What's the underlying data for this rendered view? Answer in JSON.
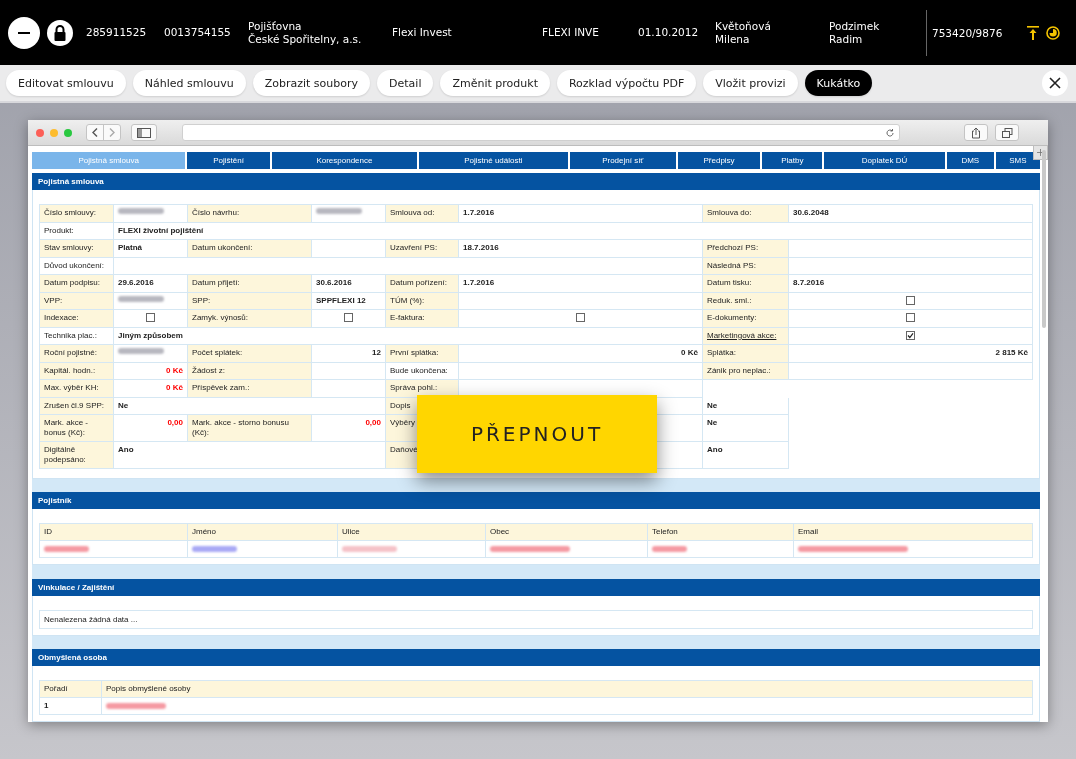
{
  "top_bar": {
    "items": [
      "285911525",
      "0013754155",
      "Pojišťovna\nČeské Spořitelny, a.s.",
      "Flexi Invest",
      "FLEXI INVE",
      "01.10.2012",
      "Květoňová\nMilena",
      "Podzimek\nRadim"
    ],
    "reference": "753420/9876"
  },
  "actions": [
    {
      "label": "Editovat smlouvu",
      "selected": false
    },
    {
      "label": "Náhled smlouvu",
      "selected": false
    },
    {
      "label": "Zobrazit soubory",
      "selected": false
    },
    {
      "label": "Detail",
      "selected": false
    },
    {
      "label": "Změnit produkt",
      "selected": false
    },
    {
      "label": "Rozklad výpočtu PDF",
      "selected": false
    },
    {
      "label": "Vložit provizi",
      "selected": false
    },
    {
      "label": "Kukátko",
      "selected": true
    }
  ],
  "browser": {
    "tabs": [
      {
        "label": "Pojistná smlouva",
        "selected": true
      },
      {
        "label": "Pojištění",
        "selected": false
      },
      {
        "label": "Korespondence",
        "selected": false
      },
      {
        "label": "Pojistné události",
        "selected": false
      },
      {
        "label": "Prodejní síť",
        "selected": false
      },
      {
        "label": "Předpisy",
        "selected": false
      },
      {
        "label": "Platby",
        "selected": false
      },
      {
        "label": "Doplatek DÚ",
        "selected": false
      },
      {
        "label": "DMS",
        "selected": false
      },
      {
        "label": "SMS",
        "selected": false
      }
    ]
  },
  "contract": {
    "title": "Pojistná smlouva",
    "rows": [
      [
        {
          "kind": "label",
          "text": "Číslo smlouvy:"
        },
        {
          "kind": "blurred",
          "color": "#b8b8c0"
        },
        {
          "kind": "label",
          "text": "Číslo návrhu:"
        },
        {
          "kind": "blurred",
          "color": "#b8b8c0"
        },
        {
          "kind": "label",
          "text": "Smlouva od:"
        },
        {
          "kind": "value",
          "text": "1.7.2016"
        },
        {
          "kind": "label",
          "text": "Smlouva do:"
        },
        {
          "kind": "value",
          "text": "30.6.2048"
        }
      ],
      [
        {
          "kind": "plain",
          "text": "Produkt:"
        },
        {
          "kind": "wide",
          "text": "FLEXI životní pojištění"
        }
      ],
      [
        {
          "kind": "label",
          "text": "Stav smlouvy:"
        },
        {
          "kind": "value",
          "text": "Platná"
        },
        {
          "kind": "label",
          "text": "Datum ukončení:"
        },
        {
          "kind": "blank"
        },
        {
          "kind": "label",
          "text": "Uzavření PS:"
        },
        {
          "kind": "value",
          "text": "18.7.2016"
        },
        {
          "kind": "label",
          "text": "Předchozí PS:"
        },
        {
          "kind": "blank"
        }
      ],
      [
        {
          "kind": "plain",
          "text": "Důvod ukončení:"
        },
        {
          "kind": "wide"
        },
        {
          "kind": "label",
          "text": "Následná PS:"
        },
        {
          "kind": "blank"
        }
      ],
      [
        {
          "kind": "label",
          "text": "Datum podpisu:"
        },
        {
          "kind": "value",
          "text": "29.6.2016"
        },
        {
          "kind": "label",
          "text": "Datum přijetí:"
        },
        {
          "kind": "value",
          "text": "30.6.2016"
        },
        {
          "kind": "label",
          "text": "Datum pořízení:"
        },
        {
          "kind": "value",
          "text": "1.7.2016"
        },
        {
          "kind": "label",
          "text": "Datum tisku:"
        },
        {
          "kind": "value",
          "text": "8.7.2016"
        }
      ],
      [
        {
          "kind": "label",
          "text": "VPP:"
        },
        {
          "kind": "blurred",
          "color": "#b8b8c0"
        },
        {
          "kind": "label",
          "text": "SPP:"
        },
        {
          "kind": "value",
          "text": "SPPFLEXI 12"
        },
        {
          "kind": "label",
          "text": "TÚM (%):"
        },
        {
          "kind": "blank"
        },
        {
          "kind": "label",
          "text": "Reduk. sml.:"
        },
        {
          "kind": "check",
          "checked": false
        }
      ],
      [
        {
          "kind": "label",
          "text": "Indexace:"
        },
        {
          "kind": "check",
          "checked": false
        },
        {
          "kind": "label",
          "text": "Zamyk. výnosů:"
        },
        {
          "kind": "check",
          "checked": false
        },
        {
          "kind": "label",
          "text": "E-faktura:"
        },
        {
          "kind": "check",
          "checked": false
        },
        {
          "kind": "label",
          "text": "E-dokumenty:"
        },
        {
          "kind": "check",
          "checked": false
        }
      ],
      [
        {
          "kind": "plain",
          "text": "Technika plac.:"
        },
        {
          "kind": "wide",
          "text": "Jiným způsobem"
        },
        {
          "kind": "link",
          "text": "Marketingová akce:"
        },
        {
          "kind": "check",
          "checked": true
        }
      ],
      [
        {
          "kind": "label",
          "text": "Roční pojistné:"
        },
        {
          "kind": "blurred",
          "color": "#b8b8c0"
        },
        {
          "kind": "label",
          "text": "Počet splátek:"
        },
        {
          "kind": "amount",
          "text": "12"
        },
        {
          "kind": "label",
          "text": "První splátka:"
        },
        {
          "kind": "amount",
          "text": "0 Kč"
        },
        {
          "kind": "label",
          "text": "Splátka:"
        },
        {
          "kind": "amount",
          "text": "2 815 Kč"
        }
      ],
      [
        {
          "kind": "label",
          "text": "Kapitál. hodn.:"
        },
        {
          "kind": "alert",
          "text": "0 Kč"
        },
        {
          "kind": "label",
          "text": "Žádost z:"
        },
        {
          "kind": "blank"
        },
        {
          "kind": "plain",
          "text": "Bude ukončena:"
        },
        {
          "kind": "blank"
        },
        {
          "kind": "label",
          "text": "Zánik pro neplac.:"
        },
        {
          "kind": "blank"
        }
      ],
      [
        {
          "kind": "label",
          "text": "Max. výběr KH:"
        },
        {
          "kind": "alert",
          "text": "0 Kč"
        },
        {
          "kind": "label",
          "text": "Příspěvek zam.:"
        },
        {
          "kind": "blank"
        },
        {
          "kind": "label",
          "text": "Správa pohl.:"
        },
        {
          "kind": "blank"
        },
        {
          "kind": "none"
        },
        {
          "kind": "none"
        }
      ],
      [
        {
          "kind": "label",
          "text": "Zrušen čl.9 SPP:"
        },
        {
          "kind": "wide",
          "text": "Ne"
        },
        {
          "kind": "label",
          "text": "Dopis"
        },
        {
          "kind": "blank"
        },
        {
          "kind": "value",
          "text": "Ne"
        },
        {
          "kind": "none"
        }
      ],
      [
        {
          "kind": "label",
          "text": "Mark. akce - bonus (Kč):"
        },
        {
          "kind": "alert",
          "text": "0,00"
        },
        {
          "kind": "label",
          "text": "Mark. akce - storno bonusu (Kč):"
        },
        {
          "kind": "alert",
          "text": "0,00"
        },
        {
          "kind": "label",
          "text": "Výběry"
        },
        {
          "kind": "blank"
        },
        {
          "kind": "value",
          "text": "Ne"
        },
        {
          "kind": "none"
        }
      ],
      [
        {
          "kind": "label",
          "text": "Digitálně podepsáno:"
        },
        {
          "kind": "wide",
          "text": "Ano"
        },
        {
          "kind": "label",
          "text": "Daňové"
        },
        {
          "kind": "blank"
        },
        {
          "kind": "value",
          "text": "Ano"
        },
        {
          "kind": "none"
        }
      ]
    ]
  },
  "overlay_button": {
    "label": "PŘEPNOUT"
  },
  "policyholder": {
    "title": "Pojistník",
    "columns": [
      "ID",
      "Jméno",
      "Ulice",
      "Obec",
      "Telefon",
      "Email"
    ],
    "rows": [
      [
        {
          "kind": "blurred",
          "color": "#f59aa3"
        },
        {
          "kind": "blurred",
          "color": "#a9a9f5"
        },
        {
          "kind": "blurred",
          "color": "#f5c2c8"
        },
        {
          "kind": "blurred",
          "color": "#f59aa3"
        },
        {
          "kind": "blurred",
          "color": "#f59aa3"
        },
        {
          "kind": "blurred",
          "color": "#f59aa3"
        }
      ]
    ]
  },
  "binding": {
    "title": "Vinkulace / Zajištění",
    "message": "Nenalezena žádná data ..."
  },
  "beneficiary": {
    "title": "Obmyšlená osoba",
    "columns": [
      "Pořadí",
      "Popis obmyšlené osoby"
    ],
    "rows": [
      [
        {
          "kind": "text",
          "text": "1"
        },
        {
          "kind": "blurred",
          "color": "#f59aa3"
        }
      ]
    ]
  }
}
